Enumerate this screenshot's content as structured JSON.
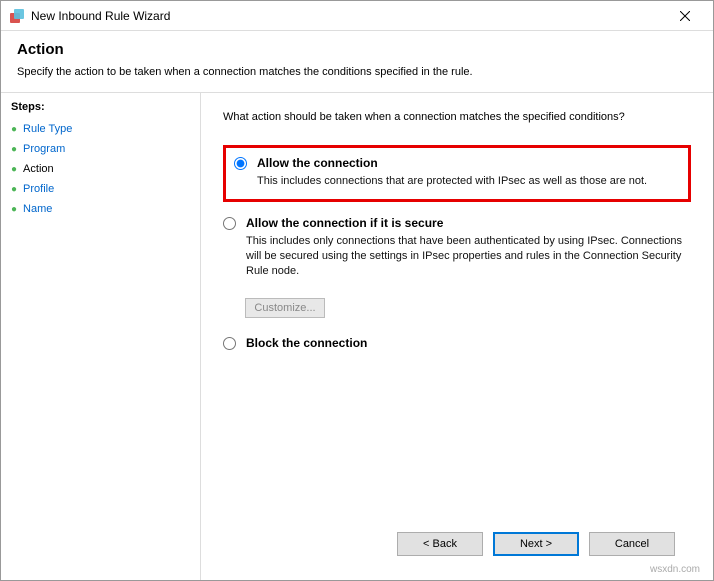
{
  "titlebar": {
    "title": "New Inbound Rule Wizard"
  },
  "header": {
    "title": "Action",
    "subtitle": "Specify the action to be taken when a connection matches the conditions specified in the rule."
  },
  "sidebar": {
    "heading": "Steps:",
    "items": [
      {
        "label": "Rule Type",
        "current": false
      },
      {
        "label": "Program",
        "current": false
      },
      {
        "label": "Action",
        "current": true
      },
      {
        "label": "Profile",
        "current": false
      },
      {
        "label": "Name",
        "current": false
      }
    ]
  },
  "content": {
    "question": "What action should be taken when a connection matches the specified conditions?",
    "options": [
      {
        "title": "Allow the connection",
        "desc": "This includes connections that are protected with IPsec as well as those are not.",
        "checked": true,
        "highlighted": true
      },
      {
        "title": "Allow the connection if it is secure",
        "desc": "This includes only connections that have been authenticated by using IPsec. Connections will be secured using the settings in IPsec properties and rules in the Connection Security Rule node.",
        "checked": false,
        "customize_label": "Customize..."
      },
      {
        "title": "Block the connection",
        "desc": "",
        "checked": false
      }
    ]
  },
  "footer": {
    "back": "< Back",
    "next": "Next >",
    "cancel": "Cancel"
  },
  "watermark": "wsxdn.com"
}
